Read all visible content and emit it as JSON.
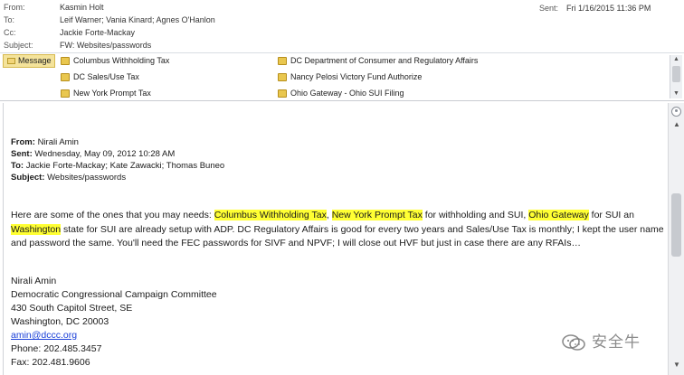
{
  "header": {
    "from_label": "From:",
    "from_value": "Kasmin Holt",
    "to_label": "To:",
    "to_value": "Leif Warner; Vania Kinard; Agnes O'Hanlon",
    "cc_label": "Cc:",
    "cc_value": "Jackie Forte-Mackay",
    "subject_label": "Subject:",
    "subject_value": "FW: Websites/passwords",
    "sent_label": "Sent:",
    "sent_value": "Fri 1/16/2015 11:36 PM"
  },
  "attachments": {
    "message_tab": "Message",
    "items": [
      "Columbus Withholding Tax",
      "DC Sales/Use Tax",
      "New York Prompt Tax",
      "DC Department of Consumer and Regulatory Affairs",
      "Nancy Pelosi Victory Fund Authorize",
      "Ohio Gateway - Ohio SUI Filing"
    ]
  },
  "forwarded": {
    "from_label": "From:",
    "from_value": "Nirali Amin",
    "sent_label": "Sent:",
    "sent_value": "Wednesday, May 09, 2012 10:28 AM",
    "to_label": "To:",
    "to_value": "Jackie Forte-Mackay; Kate Zawacki; Thomas Buneo",
    "subject_label": "Subject:",
    "subject_value": "Websites/passwords"
  },
  "body": {
    "t1": "Here are some of the ones that you may needs: ",
    "h1": "Columbus Withholding Tax",
    "t2": ", ",
    "h2": "New York Prompt Tax",
    "t3": " for withholding and SUI, ",
    "h3": "Ohio Gateway",
    "t4": " for SUI an ",
    "h4": "Washington",
    "t5": " state for SUI are already setup with ADP.  DC Regulatory Affairs is good for every two years and Sales/Use Tax is monthly; I kept the user name and password the same.  You'll need the FEC passwords for SIVF and NPVF; I will close out HVF but just in case there are any RFAIs…"
  },
  "signature": {
    "name": "Nirali Amin",
    "org": "Democratic Congressional Campaign Committee",
    "address1": "430 South Capitol Street, SE",
    "address2": "Washington, DC 20003",
    "email": "amin@dccc.org",
    "phone": "Phone: 202.485.3457",
    "fax": "Fax: 202.481.9606"
  },
  "watermark": {
    "text": "安全牛"
  },
  "colors": {
    "highlight": "#ffff33",
    "link": "#1a3fd8",
    "message_tab": "#f4e39b"
  }
}
